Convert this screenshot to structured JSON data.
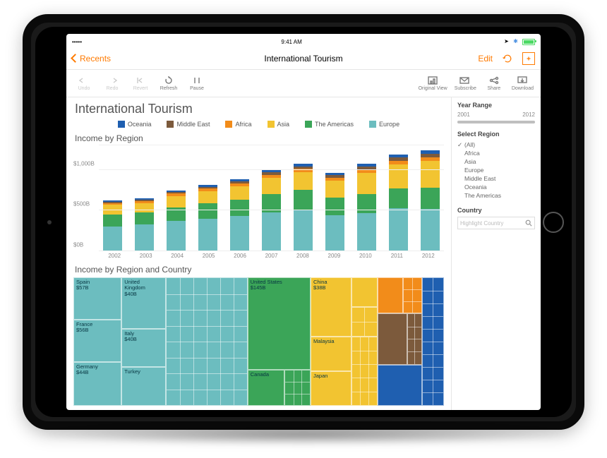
{
  "status_bar": {
    "carrier": "•••••",
    "time": "9:41 AM",
    "signal_icons": "➤ ✱",
    "battery_pct": 100
  },
  "nav": {
    "back_label": "Recents",
    "title": "International Tourism",
    "edit_label": "Edit",
    "reload_name": "reload-icon",
    "bookmark_name": "bookmark-icon"
  },
  "toolbar": {
    "undo": "Undo",
    "redo": "Redo",
    "revert": "Revert",
    "refresh": "Refresh",
    "pause": "Pause",
    "original_view": "Original View",
    "subscribe": "Subscribe",
    "share": "Share",
    "download": "Download"
  },
  "headings": {
    "title": "International Tourism",
    "chart1": "Income by Region",
    "chart2": "Income by Region and Country"
  },
  "legend": [
    {
      "label": "Oceania",
      "cls": "c-oceania"
    },
    {
      "label": "Middle East",
      "cls": "c-middleeast"
    },
    {
      "label": "Africa",
      "cls": "c-africa"
    },
    {
      "label": "Asia",
      "cls": "c-asia"
    },
    {
      "label": "The Americas",
      "cls": "c-americas"
    },
    {
      "label": "Europe",
      "cls": "c-europe"
    }
  ],
  "side": {
    "year_range": {
      "title": "Year Range",
      "from": "2001",
      "to": "2012"
    },
    "select_region": {
      "title": "Select Region",
      "items": [
        "(All)",
        "Africa",
        "Asia",
        "Europe",
        "Middle East",
        "Oceania",
        "The Americas"
      ],
      "checked": "(All)"
    },
    "country": {
      "title": "Country",
      "placeholder": "Highlight Country"
    }
  },
  "chart_data": {
    "type": "bar",
    "title": "Income by Region",
    "ylabel": "$B",
    "ylim": [
      0,
      1300
    ],
    "yticks": [
      0,
      500,
      1000
    ],
    "yticks_labels": [
      "$0B",
      "$500B",
      "$1,000B"
    ],
    "categories": [
      "2002",
      "2003",
      "2004",
      "2005",
      "2006",
      "2007",
      "2008",
      "2009",
      "2010",
      "2011",
      "2012"
    ],
    "stack_order": [
      "Europe",
      "The Americas",
      "Asia",
      "Africa",
      "Middle East",
      "Oceania"
    ],
    "series": [
      {
        "name": "Europe",
        "cls": "c-europe",
        "values": [
          300,
          330,
          370,
          400,
          430,
          480,
          510,
          445,
          470,
          530,
          520
        ]
      },
      {
        "name": "The Americas",
        "cls": "c-americas",
        "values": [
          150,
          150,
          170,
          190,
          200,
          220,
          240,
          210,
          230,
          240,
          260
        ]
      },
      {
        "name": "Asia",
        "cls": "c-asia",
        "values": [
          120,
          110,
          140,
          150,
          170,
          200,
          220,
          210,
          260,
          300,
          330
        ]
      },
      {
        "name": "Africa",
        "cls": "c-africa",
        "values": [
          20,
          25,
          28,
          30,
          35,
          40,
          42,
          40,
          42,
          42,
          45
        ]
      },
      {
        "name": "Middle East",
        "cls": "c-middleeast",
        "values": [
          15,
          18,
          20,
          22,
          25,
          30,
          32,
          30,
          35,
          38,
          40
        ]
      },
      {
        "name": "Oceania",
        "cls": "c-oceania",
        "values": [
          18,
          20,
          22,
          25,
          28,
          30,
          32,
          30,
          35,
          40,
          45
        ]
      }
    ]
  },
  "treemap_data": {
    "title": "Income by Region and Country",
    "unit": "$B",
    "tiles": [
      {
        "country": "Spain",
        "region": "Europe",
        "value": 57,
        "label": "Spain\n$57B",
        "cls": "c-europe",
        "x": 0,
        "y": 0,
        "w": 13,
        "h": 33
      },
      {
        "country": "France",
        "region": "Europe",
        "value": 56,
        "label": "France\n$56B",
        "cls": "c-europe",
        "x": 0,
        "y": 33,
        "w": 13,
        "h": 33
      },
      {
        "country": "Germany",
        "region": "Europe",
        "value": 44,
        "label": "Germany\n$44B",
        "cls": "c-europe",
        "x": 0,
        "y": 66,
        "w": 13,
        "h": 34
      },
      {
        "country": "United Kingdom",
        "region": "Europe",
        "value": 40,
        "label": "United\nKingdom\n$40B",
        "cls": "c-europe",
        "x": 13,
        "y": 0,
        "w": 12,
        "h": 40
      },
      {
        "country": "Italy",
        "region": "Europe",
        "value": 40,
        "label": "Italy\n$40B",
        "cls": "c-europe",
        "x": 13,
        "y": 40,
        "w": 12,
        "h": 30
      },
      {
        "country": "Turkey",
        "region": "Europe",
        "value": 30,
        "label": "Turkey",
        "cls": "c-europe",
        "x": 13,
        "y": 70,
        "w": 12,
        "h": 30
      },
      {
        "country": "Europe-other",
        "region": "Europe",
        "value": null,
        "label": "",
        "cls": "c-europe",
        "x": 25,
        "y": 0,
        "w": 22,
        "h": 100,
        "grid": [
          6,
          8
        ]
      },
      {
        "country": "United States",
        "region": "The Americas",
        "value": 145,
        "label": "United States\n$145B",
        "cls": "c-americas",
        "x": 47,
        "y": 0,
        "w": 17,
        "h": 72
      },
      {
        "country": "Canada",
        "region": "The Americas",
        "value": 18,
        "label": "Canada",
        "cls": "c-americas",
        "x": 47,
        "y": 72,
        "w": 10,
        "h": 28
      },
      {
        "country": "Americas-other",
        "region": "The Americas",
        "value": null,
        "label": "",
        "cls": "c-americas",
        "x": 57,
        "y": 72,
        "w": 7,
        "h": 28,
        "grid": [
          3,
          3
        ]
      },
      {
        "country": "China",
        "region": "Asia",
        "value": 38,
        "label": "China\n$38B",
        "cls": "c-asia",
        "x": 64,
        "y": 0,
        "w": 11,
        "h": 46
      },
      {
        "country": "Asia-A",
        "region": "Asia",
        "value": null,
        "label": "",
        "cls": "c-asia",
        "x": 75,
        "y": 0,
        "w": 7,
        "h": 23
      },
      {
        "country": "Asia-B",
        "region": "Asia",
        "value": null,
        "label": "",
        "cls": "c-asia",
        "x": 75,
        "y": 23,
        "w": 7,
        "h": 23,
        "grid": [
          2,
          2
        ]
      },
      {
        "country": "Malaysia",
        "region": "Asia",
        "value": 18,
        "label": "Malaysia",
        "cls": "c-asia",
        "x": 64,
        "y": 46,
        "w": 11,
        "h": 27
      },
      {
        "country": "Japan",
        "region": "Asia",
        "value": 15,
        "label": "Japan",
        "cls": "c-asia",
        "x": 64,
        "y": 73,
        "w": 11,
        "h": 27
      },
      {
        "country": "Asia-other",
        "region": "Asia",
        "value": null,
        "label": "",
        "cls": "c-asia",
        "x": 75,
        "y": 46,
        "w": 7,
        "h": 54,
        "grid": [
          3,
          5
        ]
      },
      {
        "country": "Africa-A",
        "region": "Africa",
        "value": null,
        "label": "",
        "cls": "c-africa",
        "x": 82,
        "y": 0,
        "w": 7,
        "h": 28
      },
      {
        "country": "Africa-other",
        "region": "Africa",
        "value": null,
        "label": "",
        "cls": "c-africa",
        "x": 89,
        "y": 0,
        "w": 5,
        "h": 28,
        "grid": [
          2,
          3
        ]
      },
      {
        "country": "MiddleEast-A",
        "region": "Middle East",
        "value": null,
        "label": "",
        "cls": "c-middleeast",
        "x": 82,
        "y": 28,
        "w": 8,
        "h": 40
      },
      {
        "country": "MiddleEast-other",
        "region": "Middle East",
        "value": null,
        "label": "",
        "cls": "c-middleeast",
        "x": 90,
        "y": 28,
        "w": 4,
        "h": 40,
        "grid": [
          2,
          4
        ]
      },
      {
        "country": "Oceania-A",
        "region": "Oceania",
        "value": null,
        "label": "",
        "cls": "c-oceania",
        "x": 82,
        "y": 68,
        "w": 12,
        "h": 32
      },
      {
        "country": "Oceania-other",
        "region": "Oceania",
        "value": null,
        "label": "",
        "cls": "c-oceania",
        "x": 94,
        "y": 0,
        "w": 6,
        "h": 100,
        "grid": [
          2,
          10
        ]
      }
    ]
  }
}
